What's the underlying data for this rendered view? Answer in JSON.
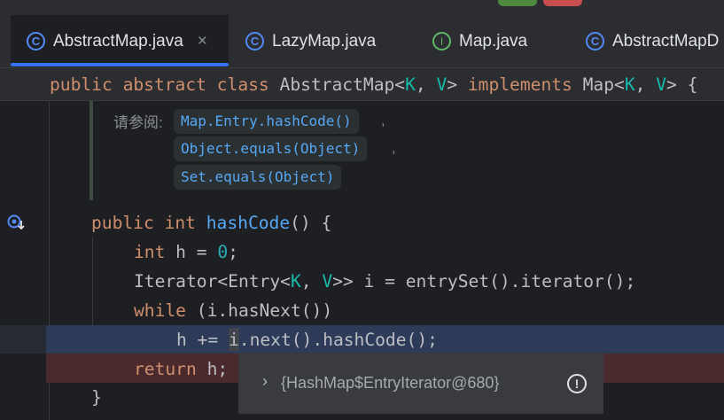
{
  "tabs": [
    {
      "label": "AbstractMap.java",
      "icon": "class-icon",
      "close": "×"
    },
    {
      "label": "LazyMap.java",
      "icon": "class-icon"
    },
    {
      "label": "Map.java",
      "icon": "interface-icon"
    },
    {
      "label": "AbstractMapD",
      "icon": "class-icon"
    }
  ],
  "tab_icon_glyphs": {
    "class": "C",
    "interface": "I"
  },
  "sticky_header": {
    "kw1": "public",
    "kw2": "abstract",
    "kw3": "class",
    "name": "AbstractMap",
    "lt": "<",
    "k": "K",
    "comma": ", ",
    "v": "V",
    "gt": ">",
    "kw4": "implements",
    "iface": "Map",
    "brace": " {"
  },
  "javadoc": {
    "label": "请参阅:",
    "links": [
      "Map.Entry.hashCode()",
      "Object.equals(Object)",
      "Set.equals(Object)"
    ],
    "comma": ","
  },
  "code": {
    "l1": {
      "kw": "public",
      "type": "int",
      "fn": "hashCode",
      "rest": "() {"
    },
    "l2": {
      "type": "int",
      "mid": " h = ",
      "num": "0",
      "end": ";"
    },
    "l3": {
      "a": "Iterator<Entry<",
      "k": "K",
      "comma": ", ",
      "v": "V",
      "b": ">> i = entrySet().iterator();"
    },
    "l4": {
      "kw": "while",
      "rest": " (i.hasNext())"
    },
    "l5": {
      "text": "h += i.next().hashCode();"
    },
    "l6": {
      "kw": "return",
      "rest": " h;"
    },
    "l7": {
      "text": "}"
    }
  },
  "debugger_popup": {
    "chevron": "›",
    "value": "{HashMap$EntryIterator@680}",
    "warn": "!"
  },
  "colors": {
    "keyword": "#cf8e6d",
    "type_param": "#16baac",
    "function": "#56a8f5",
    "number": "#2aacb8",
    "accent": "#3574f0"
  }
}
